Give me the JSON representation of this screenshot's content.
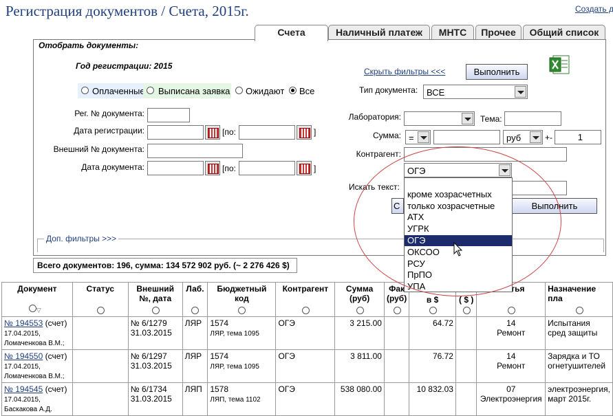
{
  "page": {
    "title": "Регистрация документов / Счета,  2015г.",
    "create_link": "Создать д"
  },
  "tabs": [
    "Счета",
    "Наличный платеж",
    "МНТС",
    "Прочее",
    "Общий список"
  ],
  "filters": {
    "header": "Отобрать документы:",
    "year": "Год регистрации: 2015",
    "reset_link": "Скрыть фильтры <<<",
    "run_button": "Выполнить",
    "status_options": [
      "Оплаченные",
      "Выписана заявка",
      "Ожидают",
      "Все"
    ],
    "reg_no_label": "Рег. № документа:",
    "reg_date_label": "Дата регистрации:",
    "ext_no_label": "Внешний № документа:",
    "doc_date_label": "Дата документа:",
    "po_label": "[по:",
    "bracket": "]",
    "doc_type_label": "Тип документа:",
    "doc_type_value": "ВСЕ",
    "lab_label": "Лаборатория:",
    "theme_label": "Тема:",
    "sum_label": "Сумма:",
    "sum_op": "=",
    "currency": "руб",
    "pm": "+-",
    "tolerance": "1",
    "contractor_label": "Контрагент:",
    "contractor_select": "ОГЭ",
    "search_label": "Искать текст:",
    "run_button2": "Выполнить",
    "btn_partial": "С",
    "extra_filters": "Доп. фильтры >>>"
  },
  "dropdown": {
    "items": [
      "кроме хозрасчетных",
      "только хозрасчетные",
      "АТХ",
      "УГРК",
      "ОГЭ",
      "ОКСОО",
      "РСУ",
      "ПрПО",
      "УПА"
    ],
    "selected_index": 4
  },
  "totals": "Всего документов: 196,   сумма: 134 572 902 руб.   (~ 2 276 426 $)",
  "table": {
    "headers": [
      "Документ",
      "Статус",
      "Внешний №, дата",
      "Лаб.",
      "Бюджетный код",
      "Контрагент",
      "Сумма (руб)",
      "Фак (руб)",
      "в $",
      "( $ )",
      "статья",
      "Назначение пла"
    ],
    "rows": [
      {
        "doc": "№ 194553",
        "doc_type": "(счет)",
        "date": "17.04.2015,",
        "person": "Ломаченкова В.М.;",
        "ext": "№ 6/1279",
        "ext_date": "31.03.2015",
        "lab": "ЛЯР",
        "code": "1574",
        "code_sub": "ЛЯР, тема 1095",
        "contractor": "ОГЭ",
        "sum": "3 215.00",
        "usd": "64.72",
        "item_no": "14",
        "item": "Ремонт",
        "purpose": "Испытания сред защиты"
      },
      {
        "doc": "№ 194550",
        "doc_type": "(счет)",
        "date": "17.04.2015,",
        "person": "Ломаченкова В.М.;",
        "ext": "№ 6/1297",
        "ext_date": "31.03.2015",
        "lab": "ЛЯР",
        "code": "1574",
        "code_sub": "ЛЯР, тема 1095",
        "contractor": "ОГЭ",
        "sum": "3 811.00",
        "usd": "76.72",
        "item_no": "14",
        "item": "Ремонт",
        "purpose": "Зарядка и ТО огнетушителей"
      },
      {
        "doc": "№ 194545",
        "doc_type": "(счет)",
        "date": "17.04.2015,",
        "person": "Баскакова А.Д.",
        "ext": "№ 6/1734",
        "ext_date": "31.03.2015",
        "lab": "ЛЯП",
        "code": "1578",
        "code_sub": "ЛЯП, тема 1102",
        "contractor": "ОГЭ",
        "sum": "538 080.00",
        "usd": "10 832.03",
        "item_no": "07",
        "item": "Электроэнергия",
        "purpose": "электроэнергия, март 2015г."
      }
    ]
  }
}
